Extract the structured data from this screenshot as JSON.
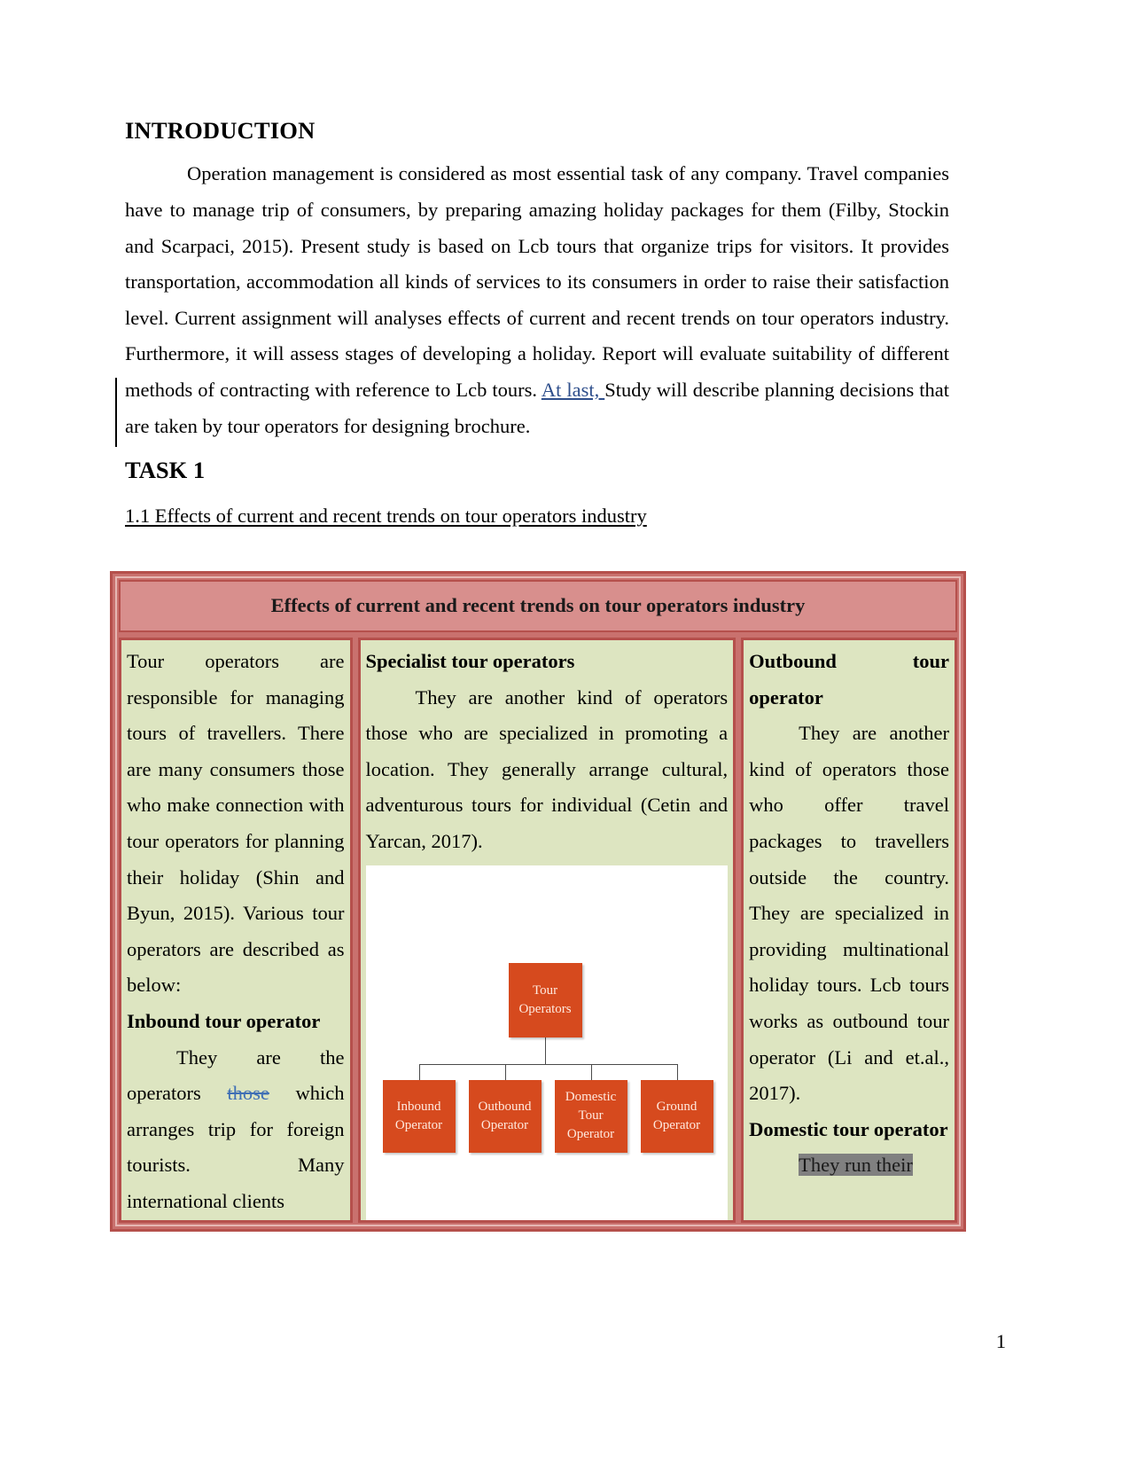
{
  "document": {
    "heading": "INTRODUCTION",
    "intro_paragraph": {
      "segment_1": "Operation management is considered as most essential task of any company. Travel companies have to manage trip of consumers, by preparing amazing holiday packages for them (Filby, Stockin and Scarpaci, 2015). Present study is based on Lcb tours that organize trips for visitors. It provides transportation, accommodation all kinds of services to its consumers in order to raise their satisfaction level.  Current assignment will analyses effects of current and recent trends  on tour operators industry. Furthermore, it will assess stages of developing a holiday. Report will evaluate suitability of different methods of contracting with reference to Lcb tours. ",
      "inserted_text": "At last, ",
      "segment_2": "Study will describe planning decisions that are taken by tour operators for designing brochure."
    },
    "task_heading": "TASK 1",
    "subheading": "1.1 Effects of current and recent trends on tour operators industry",
    "page_number": "1"
  },
  "table": {
    "header": "Effects of current and recent trends on tour operators industry",
    "col1": {
      "intro": "Tour operators are responsible for managing tours of travellers. There are many consumers those who make connection with tour operators for planning their holiday (Shin and Byun, 2015). Various tour operators are described as below:",
      "title": "Inbound tour operator",
      "body_before_deletion": "They are the operators ",
      "deleted_text": "those",
      "body_after_deletion": " which arranges trip for foreign tourists. Many international clients"
    },
    "col2": {
      "title": "Specialist tour operators",
      "body": "They are another kind of operators those who are specialized in promoting a location. They generally arrange cultural, adventurous tours for individual (Cetin and Yarcan, 2017)."
    },
    "col3": {
      "title_1": "Outbound tour operator",
      "body_1": "They are another kind of operators those who offer travel packages to travellers outside the country. They are specialized in providing multinational holiday tours. Lcb tours works as outbound tour operator (Li and et.al., 2017).",
      "title_2": "Domestic tour operator",
      "body_2_highlighted": "They run their"
    }
  },
  "orgchart": {
    "root": {
      "line1": "Tour",
      "line2": "Operators"
    },
    "leaves": [
      {
        "line1": "Inbound",
        "line2": "Operator"
      },
      {
        "line1": "Outbound",
        "line2": "Operator"
      },
      {
        "line1": "Domestic Tour",
        "line2": "Operator"
      },
      {
        "line1": "Ground",
        "line2": "Operator"
      }
    ]
  },
  "colors": {
    "table_border": "#b5504c",
    "table_header_bg": "#d88f8d",
    "cell_bg": "#dde5c1",
    "node_fill": "#d64a1e",
    "insertion": "#2f4f8c",
    "deletion": "#3f6fb5",
    "selection_highlight": "#808080"
  }
}
